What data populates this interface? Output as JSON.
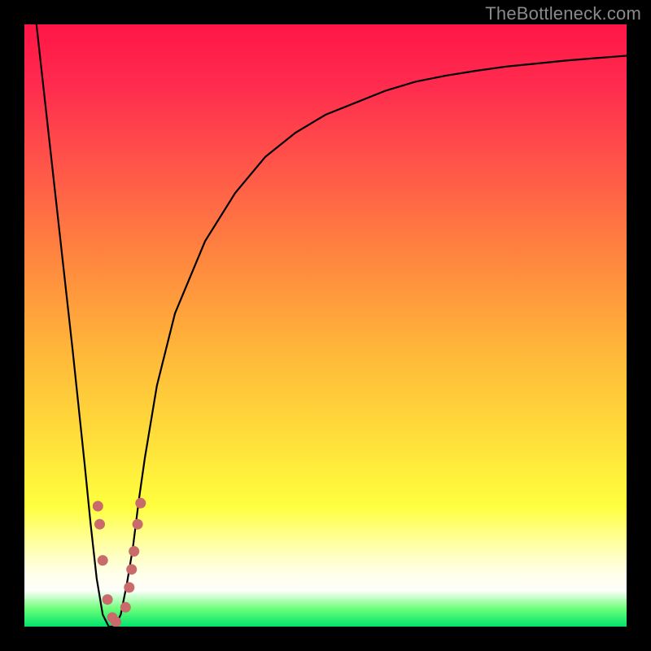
{
  "watermark": {
    "text": "TheBottleneck.com"
  },
  "colors": {
    "frame": "#000000",
    "curve": "#000000",
    "marker": "#c96b6b",
    "gradient_stops": [
      "#ff1647",
      "#ff5a48",
      "#ffb93a",
      "#ffff3e",
      "#ffffe8",
      "#00e46a"
    ]
  },
  "chart_data": {
    "type": "line",
    "title": "",
    "xlabel": "",
    "ylabel": "",
    "xlim": [
      0,
      100
    ],
    "ylim": [
      0,
      100
    ],
    "grid": false,
    "legend": null,
    "series": [
      {
        "name": "bottleneck-curve",
        "x": [
          2,
          4,
          6,
          8,
          10,
          11,
          12,
          13,
          14,
          15,
          16,
          17,
          18,
          19,
          20,
          22,
          25,
          30,
          35,
          40,
          45,
          50,
          55,
          60,
          65,
          70,
          75,
          80,
          85,
          90,
          95,
          100
        ],
        "y": [
          100,
          82,
          64,
          46,
          27,
          17,
          8,
          2,
          0,
          0,
          2,
          7,
          13,
          21,
          28,
          40,
          52,
          64,
          72,
          78,
          82,
          85,
          87,
          89,
          90.5,
          91.5,
          92.3,
          93,
          93.5,
          94,
          94.4,
          94.8
        ]
      }
    ],
    "markers": [
      {
        "x": 12.2,
        "y": 20
      },
      {
        "x": 12.5,
        "y": 17
      },
      {
        "x": 13.0,
        "y": 11
      },
      {
        "x": 13.8,
        "y": 4.5
      },
      {
        "x": 14.6,
        "y": 1.5
      },
      {
        "x": 15.2,
        "y": 0.8
      },
      {
        "x": 16.8,
        "y": 3.2
      },
      {
        "x": 17.4,
        "y": 6.5
      },
      {
        "x": 17.8,
        "y": 9.5
      },
      {
        "x": 18.2,
        "y": 12.5
      },
      {
        "x": 18.8,
        "y": 17
      },
      {
        "x": 19.3,
        "y": 20.5
      }
    ]
  }
}
